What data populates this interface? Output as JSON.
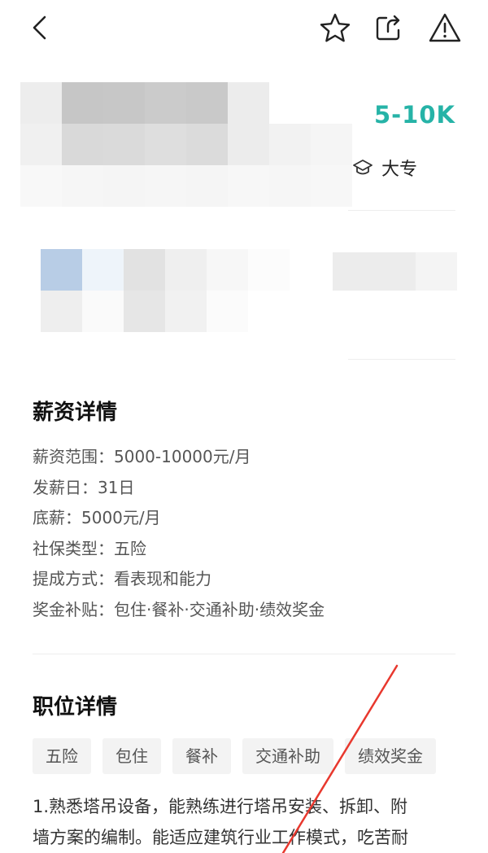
{
  "header": {
    "back_icon": "chevron-left-icon",
    "favorite_icon": "star-outline-icon",
    "share_icon": "share-icon",
    "report_icon": "warning-icon"
  },
  "job": {
    "salary": "5-10K",
    "education": "大专",
    "education_icon": "graduation-cap-icon"
  },
  "salary_details": {
    "title": "薪资详情",
    "items": [
      "薪资范围：5000-10000元/月",
      "发薪日：31日",
      "底薪：5000元/月",
      "社保类型：五险",
      "提成方式：看表现和能力",
      "奖金补贴：包住·餐补·交通补助·绩效奖金"
    ]
  },
  "position_details": {
    "title": "职位详情",
    "tags": [
      "五险",
      "包住",
      "餐补",
      "交通补助",
      "绩效奖金"
    ],
    "description": [
      "1.熟悉塔吊设备，能熟练进行塔吊安装、拆卸、附",
      "墙方案的编制。能适应建筑行业工作模式，吃苦耐"
    ]
  },
  "colors": {
    "accent": "#26b3a7",
    "annotation": "#e8382e"
  }
}
